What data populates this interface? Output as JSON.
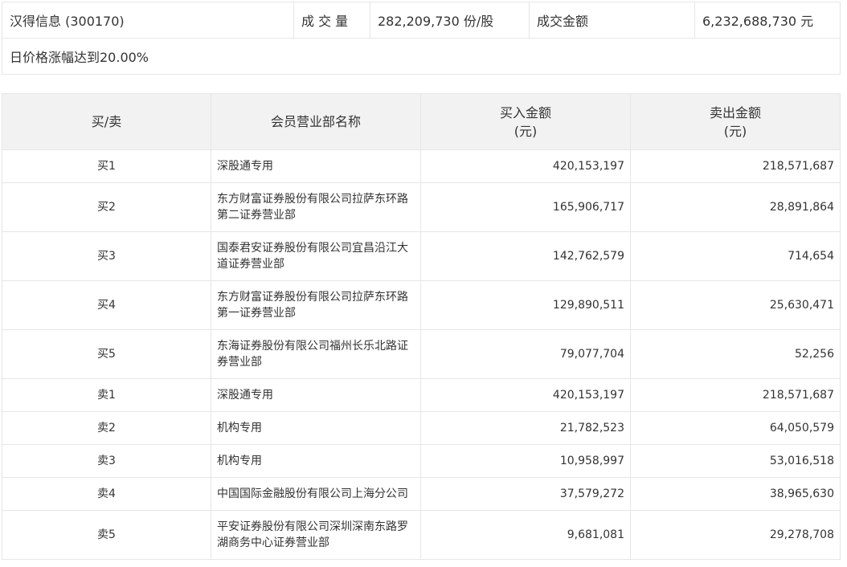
{
  "summary": {
    "stock_name": "汉得信息 (300170)",
    "volume_label": "成 交 量",
    "volume_value": "282,209,730 份/股",
    "amount_label": "成交金额",
    "amount_value": "6,232,688,730 元",
    "reason": "日价格涨幅达到20.00%"
  },
  "table": {
    "headers": {
      "side": "买/卖",
      "dept": "会员营业部名称",
      "buy_line1": "买入金额",
      "buy_line2": "(元)",
      "sell_line1": "卖出金额",
      "sell_line2": "(元)"
    },
    "rows": [
      {
        "side": "买1",
        "name": "深股通专用",
        "buy": "420,153,197",
        "sell": "218,571,687"
      },
      {
        "side": "买2",
        "name": "东方财富证券股份有限公司拉萨东环路第二证券营业部",
        "buy": "165,906,717",
        "sell": "28,891,864"
      },
      {
        "side": "买3",
        "name": "国泰君安证券股份有限公司宜昌沿江大道证券营业部",
        "buy": "142,762,579",
        "sell": "714,654"
      },
      {
        "side": "买4",
        "name": "东方财富证券股份有限公司拉萨东环路第一证券营业部",
        "buy": "129,890,511",
        "sell": "25,630,471"
      },
      {
        "side": "买5",
        "name": "东海证券股份有限公司福州长乐北路证券营业部",
        "buy": "79,077,704",
        "sell": "52,256"
      },
      {
        "side": "卖1",
        "name": "深股通专用",
        "buy": "420,153,197",
        "sell": "218,571,687"
      },
      {
        "side": "卖2",
        "name": "机构专用",
        "buy": "21,782,523",
        "sell": "64,050,579"
      },
      {
        "side": "卖3",
        "name": "机构专用",
        "buy": "10,958,997",
        "sell": "53,016,518"
      },
      {
        "side": "卖4",
        "name": "中国国际金融股份有限公司上海分公司",
        "buy": "37,579,272",
        "sell": "38,965,630"
      },
      {
        "side": "卖5",
        "name": "平安证券股份有限公司深圳深南东路罗湖商务中心证券营业部",
        "buy": "9,681,081",
        "sell": "29,278,708"
      }
    ]
  }
}
